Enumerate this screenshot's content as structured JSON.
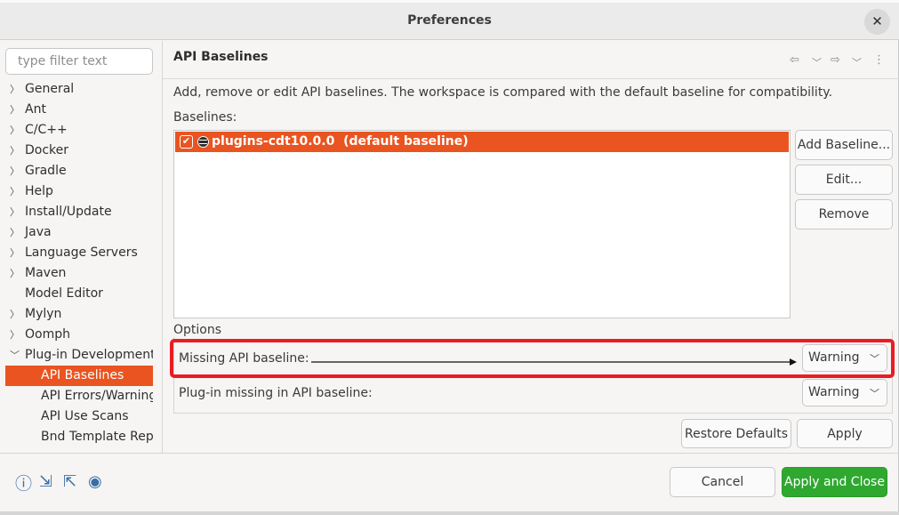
{
  "window": {
    "title": "Preferences"
  },
  "filter": {
    "placeholder": "type filter text"
  },
  "tree": {
    "items": [
      {
        "label": "General",
        "expandable": true,
        "expanded": false
      },
      {
        "label": "Ant",
        "expandable": true,
        "expanded": false
      },
      {
        "label": "C/C++",
        "expandable": true,
        "expanded": false
      },
      {
        "label": "Docker",
        "expandable": true,
        "expanded": false
      },
      {
        "label": "Gradle",
        "expandable": true,
        "expanded": false
      },
      {
        "label": "Help",
        "expandable": true,
        "expanded": false
      },
      {
        "label": "Install/Update",
        "expandable": true,
        "expanded": false
      },
      {
        "label": "Java",
        "expandable": true,
        "expanded": false
      },
      {
        "label": "Language Servers",
        "expandable": true,
        "expanded": false
      },
      {
        "label": "Maven",
        "expandable": true,
        "expanded": false
      },
      {
        "label": "Model Editor",
        "expandable": false,
        "expanded": false
      },
      {
        "label": "Mylyn",
        "expandable": true,
        "expanded": false
      },
      {
        "label": "Oomph",
        "expandable": true,
        "expanded": false
      },
      {
        "label": "Plug-in Development",
        "expandable": true,
        "expanded": true
      },
      {
        "label": "API Baselines",
        "child": true,
        "selected": true
      },
      {
        "label": "API Errors/Warnings",
        "child": true
      },
      {
        "label": "API Use Scans",
        "child": true
      },
      {
        "label": "Bnd Template Repository",
        "child": true
      }
    ]
  },
  "page": {
    "title": "API Baselines",
    "description": "Add, remove or edit API baselines. The workspace is compared with the default baseline for compatibility.",
    "baselines_label": "Baselines:",
    "baselines": [
      {
        "name": "plugins-cdt10.0.0",
        "suffix": "(default baseline)",
        "checked": true
      }
    ],
    "buttons": {
      "add": "Add Baseline...",
      "edit": "Edit...",
      "remove": "Remove"
    },
    "options": {
      "legend": "Options",
      "missing_baseline": {
        "label": "Missing API baseline:",
        "value": "Warning"
      },
      "plugin_missing": {
        "label": "Plug-in missing in API baseline:",
        "value": "Warning"
      }
    },
    "restore_defaults": "Restore Defaults",
    "apply": "Apply"
  },
  "footer": {
    "cancel": "Cancel",
    "apply_and_close": "Apply and Close"
  },
  "colors": {
    "selection": "#e95420",
    "primary": "#2fa830",
    "highlight": "#ea1c22"
  }
}
